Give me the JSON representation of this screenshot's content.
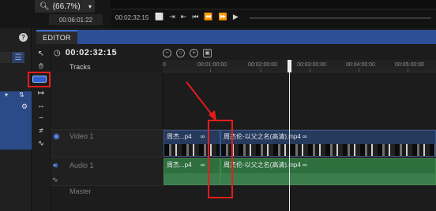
{
  "toolbar": {
    "zoom_label": "(66.7%)",
    "zoom_icon": "search-icon",
    "left_time": "00:06:01:22"
  },
  "preview": {
    "time": "00:02:32:15"
  },
  "editor": {
    "tab_label": "EDITOR",
    "timecode": "00:02:32:15",
    "tracks_label": "Tracks"
  },
  "ruler": {
    "zero": "0",
    "t1": "00:01:00:00",
    "t2": "00:02:00:00",
    "t3": "00:03:00:00",
    "t4": "00:04:00:00",
    "t5": "00:05:00:00"
  },
  "tracks": {
    "video_label": "Video 1",
    "audio_label": "Audio 1",
    "master_label": "Master"
  },
  "clips": {
    "video_a": "周杰...p4",
    "video_a_fx": "∞",
    "video_b": "周杰伦-以父之名(高清).mp4",
    "video_b_fx": "∞",
    "audio_a": "周杰...p4",
    "audio_a_fx": "∞",
    "audio_b": "周杰伦-以父之名(高清).mp4",
    "audio_b_fx": "∞"
  },
  "colors": {
    "accent_blue": "#2d4f96",
    "video_clip": "#263a5e",
    "audio_clip": "#2e6f3e",
    "highlight_red": "#e61c1c"
  }
}
